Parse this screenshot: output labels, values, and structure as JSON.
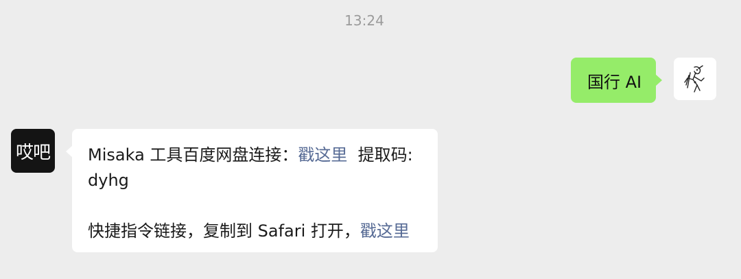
{
  "chat": {
    "timestamp": "13:24"
  },
  "messages": {
    "outgoing": {
      "text": "国行 AI"
    },
    "incoming": {
      "avatar_text": "哎吧",
      "line1_prefix": "Misaka 工具百度网盘连接：",
      "link1": "戳这里",
      "line1_suffix": "  提取码:",
      "line2": "dyhg",
      "line3_prefix": "快捷指令链接，复制到 Safari 打开，",
      "link2": "戳这里"
    }
  },
  "colors": {
    "background": "#ededed",
    "outgoing_bubble": "#95ec69",
    "incoming_bubble": "#ffffff",
    "link": "#576b95",
    "timestamp": "#9b9b9b"
  }
}
